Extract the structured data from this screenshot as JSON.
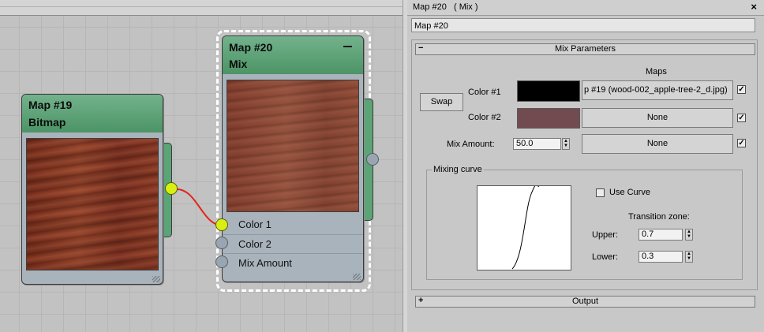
{
  "node_editor": {
    "nodes": [
      {
        "id": "map19",
        "title": "Map #19",
        "subtitle": "Bitmap"
      },
      {
        "id": "map20",
        "title": "Map #20",
        "subtitle": "Mix",
        "sockets": [
          "Color 1",
          "Color 2",
          "Mix Amount"
        ]
      }
    ]
  },
  "panel": {
    "title": "Map #20   ( Mix )",
    "close_glyph": "×",
    "map_name": "Map #20",
    "mix_parameters": {
      "rollout_label": "Mix Parameters",
      "collapse_sign": "−",
      "maps_header": "Maps",
      "swap_label": "Swap",
      "color1_label": "Color #1",
      "color1_swatch": "#000000",
      "color1_map": "p #19 (wood-002_apple-tree-2_d.jpg)",
      "color2_label": "Color #2",
      "color2_swatch": "#724b50",
      "color2_map": "None",
      "mix_amount_label": "Mix Amount:",
      "mix_amount_value": "50.0",
      "mix_amount_map": "None",
      "checkmark": "✓",
      "mixing_curve_label": "Mixing curve",
      "use_curve_label": "Use Curve",
      "transition_zone_label": "Transition zone:",
      "upper_label": "Upper:",
      "upper_value": "0.7",
      "lower_label": "Lower:",
      "lower_value": "0.3",
      "spin_up": "▲",
      "spin_down": "▼"
    },
    "output": {
      "rollout_label": "Output",
      "expand_sign": "+"
    }
  },
  "colors": {
    "node_header": "#5aa475",
    "node_body": "#a9b3bb",
    "wire": "#e2251c",
    "live_socket": "#d9ee12"
  }
}
